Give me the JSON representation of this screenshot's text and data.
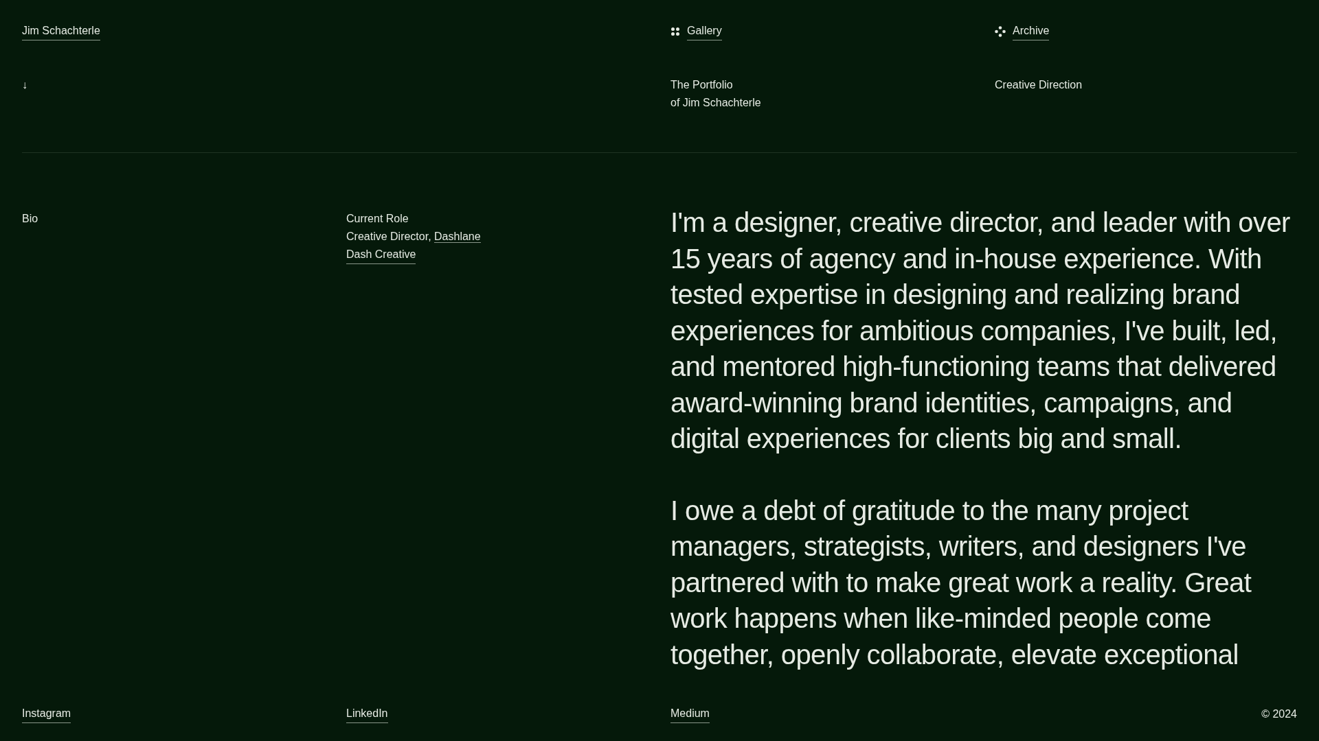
{
  "header": {
    "name_link": "Jim Schachterle",
    "nav": [
      {
        "label": "Gallery",
        "kind": "gallery"
      },
      {
        "label": "Archive",
        "kind": "archive"
      }
    ]
  },
  "intro": {
    "arrow": "↓",
    "title_lines": [
      "The Portfolio",
      "of Jim Schachterle"
    ],
    "discipline": "Creative Direction"
  },
  "bio": {
    "label": "Bio",
    "role_heading": "Current Role",
    "role_text": "Creative Director,",
    "role_links": [
      "Dashlane",
      "Dash Creative"
    ],
    "paragraphs": [
      "I'm a designer, creative director, and leader with over 15 years of agency and in-house experience. With tested expertise in designing and realizing brand experiences for ambitious companies, I've built, led, and mentored high-functioning teams that delivered award-winning brand identities, campaigns, and digital experiences for clients big and small.",
      "I owe a debt of gratitude to the many project managers, strategists, writers, and designers I've partnered with to make great work a reality. Great work happens when like-minded people come together, openly collaborate, elevate exceptional"
    ]
  },
  "footer": {
    "links": [
      "Instagram",
      "LinkedIn",
      "Medium"
    ],
    "copyright": "© 2024"
  }
}
